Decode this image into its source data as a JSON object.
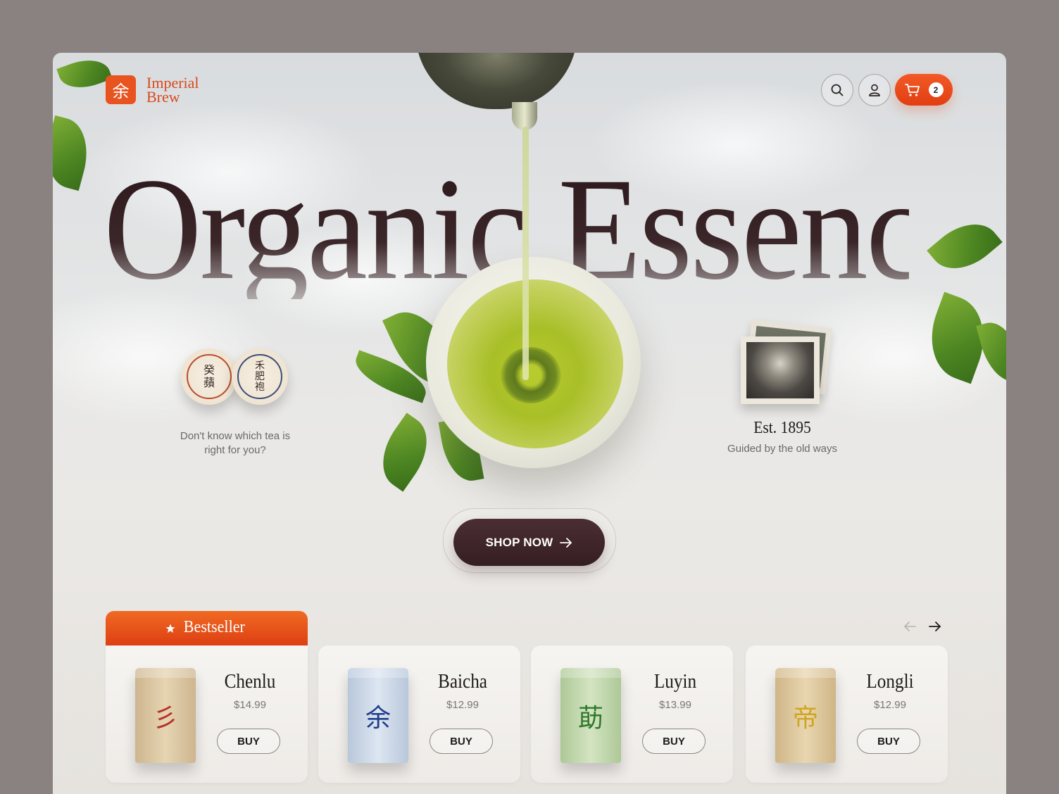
{
  "brand": {
    "line1": "Imperial",
    "line2": "Brew",
    "mark_glyph": "余"
  },
  "header": {
    "cart_count": "2"
  },
  "hero": {
    "headline": "Organic Essence",
    "tin_glyphs": [
      "癸\n蘋",
      "禾\n肥\n袍"
    ],
    "hint_text": "Don't know which tea is right for you?",
    "est_title": "Est. 1895",
    "est_subtitle": "Guided by the old ways",
    "cta_label": "SHOP NOW"
  },
  "products": {
    "badge_label": "Bestseller",
    "buy_label": "BUY",
    "items": [
      {
        "name": "Chenlu",
        "price": "$14.99",
        "glyph": "彡",
        "pouch_color": "#dcc7a3",
        "glyph_color": "#b3342a"
      },
      {
        "name": "Baicha",
        "price": "$12.99",
        "glyph": "余",
        "pouch_color": "#c9d6e6",
        "glyph_color": "#1f3e8c"
      },
      {
        "name": "Luyin",
        "price": "$13.99",
        "glyph": "莇",
        "pouch_color": "#c2d7ad",
        "glyph_color": "#2f7a2c"
      },
      {
        "name": "Longli",
        "price": "$12.99",
        "glyph": "帝",
        "pouch_color": "#dcc49a",
        "glyph_color": "#d0a620"
      }
    ]
  },
  "colors": {
    "accent": "#e8531f",
    "dark": "#351e22",
    "muted_text": "#6c6866"
  },
  "icons": [
    "search-icon",
    "user-icon",
    "cart-icon",
    "arrow-right-icon",
    "star-icon",
    "arrow-left-icon"
  ]
}
